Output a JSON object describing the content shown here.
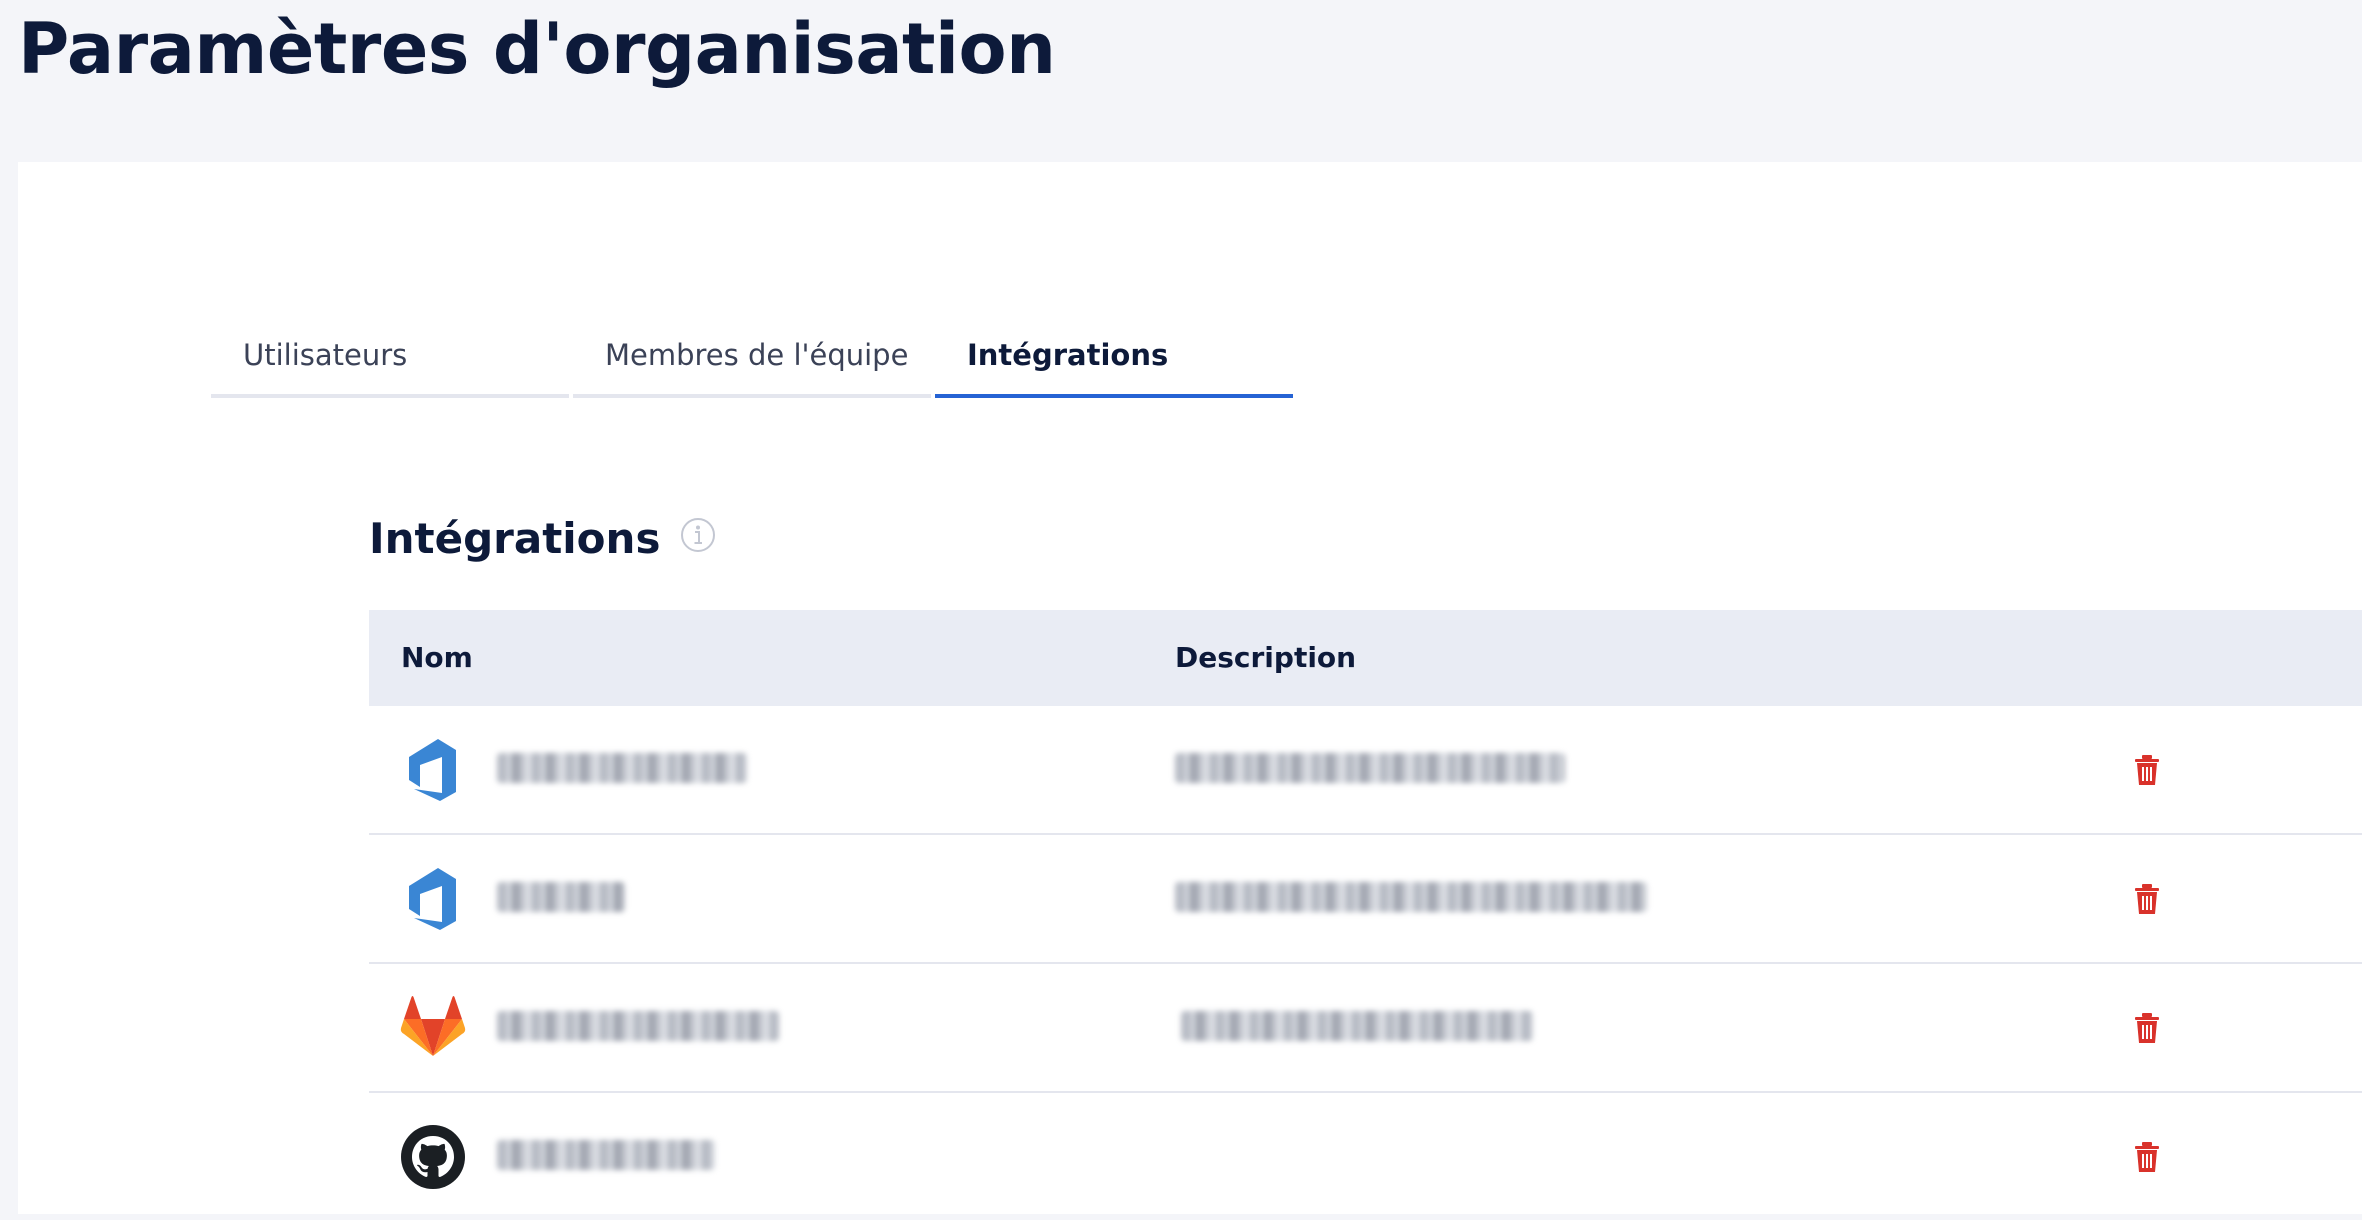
{
  "page": {
    "title": "Paramètres d'organisation"
  },
  "tabs": [
    {
      "label": "Utilisateurs",
      "active": false
    },
    {
      "label": "Membres de l'équipe",
      "active": false
    },
    {
      "label": "Intégrations",
      "active": true
    }
  ],
  "section": {
    "title": "Intégrations",
    "info_icon": "info-circle-icon"
  },
  "table": {
    "columns": {
      "name": "Nom",
      "description": "Description"
    },
    "rows": [
      {
        "provider": "azure-devops",
        "icon": "azure-devops-icon",
        "name_redacted": true,
        "description_redacted": true,
        "action_icon": "trash-icon"
      },
      {
        "provider": "azure-devops",
        "icon": "azure-devops-icon",
        "name_redacted": true,
        "description_redacted": true,
        "action_icon": "trash-icon"
      },
      {
        "provider": "gitlab",
        "icon": "gitlab-icon",
        "name_redacted": true,
        "description_redacted": true,
        "action_icon": "trash-icon"
      },
      {
        "provider": "github",
        "icon": "github-icon",
        "name_redacted": true,
        "description_redacted": false,
        "action_icon": "trash-icon"
      }
    ]
  },
  "colors": {
    "accent": "#2563d4",
    "title": "#0d1a3a",
    "delete": "#d9322b",
    "azure": "#3a86d4",
    "header_bg": "#e9ecf4",
    "page_bg": "#f4f5f9"
  }
}
